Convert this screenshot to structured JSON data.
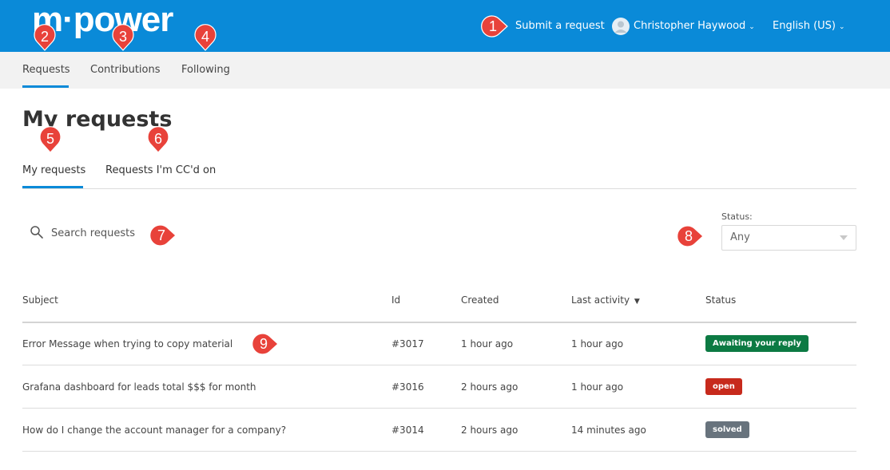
{
  "brand": {
    "logo_text": "m·power",
    "header_color": "#0a8ad8"
  },
  "header": {
    "submit_label": "Submit a request",
    "user_name": "Christopher Haywood",
    "language": "English (US)"
  },
  "subnav": {
    "items": [
      "Requests",
      "Contributions",
      "Following"
    ]
  },
  "page": {
    "title": "My requests"
  },
  "tabs": [
    "My requests",
    "Requests I'm CC'd on"
  ],
  "search": {
    "placeholder": "Search requests"
  },
  "status_filter": {
    "label": "Status:",
    "value": "Any"
  },
  "table": {
    "columns": [
      "Subject",
      "Id",
      "Created",
      "Last activity",
      "Status"
    ],
    "sort_indicator": "▼",
    "rows": [
      {
        "subject": "Error Message when trying to copy material",
        "id": "#3017",
        "created": "1 hour ago",
        "last_activity": "1 hour ago",
        "status": "Awaiting your reply",
        "status_color": "#0c7a43"
      },
      {
        "subject": "Grafana dashboard for leads total $$$ for month",
        "id": "#3016",
        "created": "2 hours ago",
        "last_activity": "1 hour ago",
        "status": "open",
        "status_color": "#c72a1c"
      },
      {
        "subject": "How do I change the account manager for a company?",
        "id": "#3014",
        "created": "2 hours ago",
        "last_activity": "14 minutes ago",
        "status": "solved",
        "status_color": "#68737d"
      }
    ]
  },
  "annotations": [
    "1",
    "2",
    "3",
    "4",
    "5",
    "6",
    "7",
    "8",
    "9"
  ],
  "annotation_color": "#e8423a"
}
